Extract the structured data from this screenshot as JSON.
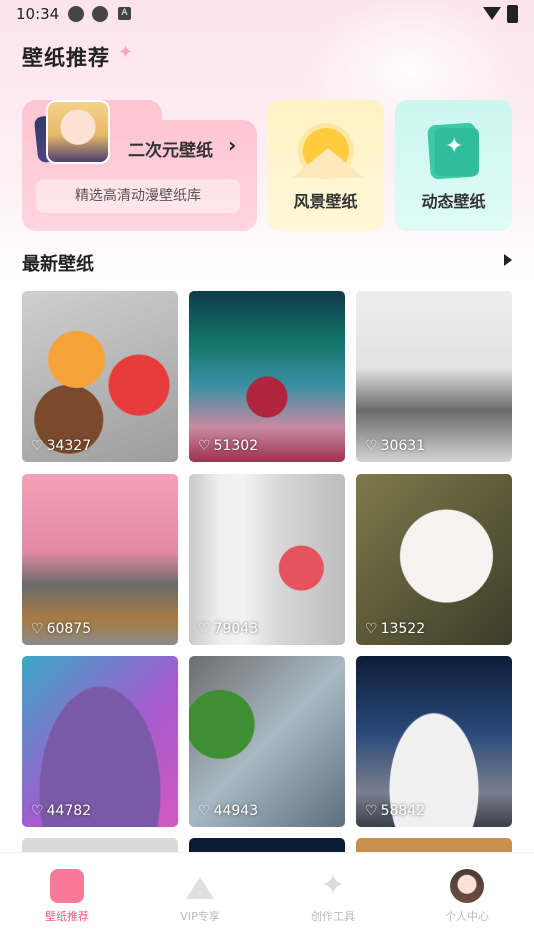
{
  "status_bar": {
    "time": "10:34"
  },
  "header": {
    "title": "壁纸推荐"
  },
  "categories": {
    "anime": {
      "label": "二次元壁纸",
      "subtitle": "精选高清动漫壁纸库"
    },
    "scenery": {
      "label": "风景壁纸"
    },
    "live": {
      "label": "动态壁纸"
    }
  },
  "latest": {
    "title": "最新壁纸",
    "items": [
      {
        "likes": "34327"
      },
      {
        "likes": "51302"
      },
      {
        "likes": "30631"
      },
      {
        "likes": "60875"
      },
      {
        "likes": "79043"
      },
      {
        "likes": "13522"
      },
      {
        "likes": "44782"
      },
      {
        "likes": "44943"
      },
      {
        "likes": "58842"
      }
    ]
  },
  "nav": {
    "items": [
      {
        "label": "壁纸推荐",
        "icon": "wallpaper-icon",
        "active": true
      },
      {
        "label": "VIP专享",
        "icon": "crown-icon",
        "active": false
      },
      {
        "label": "创作工具",
        "icon": "sparkle-icon",
        "active": false
      },
      {
        "label": "个人中心",
        "icon": "avatar-icon",
        "active": false
      }
    ]
  },
  "colors": {
    "accent": "#f35c80",
    "anime_card": "#ffc6d3",
    "scenery_card": "#fff2c4",
    "live_card": "#cbf7ef"
  }
}
